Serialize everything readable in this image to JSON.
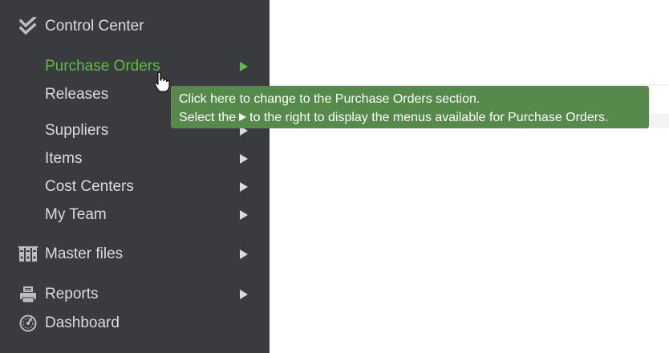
{
  "sidebar": {
    "items": [
      {
        "key": "control_center",
        "label": "Control Center",
        "icon": "double-check-icon",
        "has_arrow": false,
        "active": false
      },
      {
        "key": "purchase_orders",
        "label": "Purchase Orders",
        "icon": "",
        "has_arrow": true,
        "active": true
      },
      {
        "key": "releases",
        "label": "Releases",
        "icon": "",
        "has_arrow": false,
        "active": false
      },
      {
        "key": "suppliers",
        "label": "Suppliers",
        "icon": "",
        "has_arrow": true,
        "active": false
      },
      {
        "key": "items",
        "label": "Items",
        "icon": "",
        "has_arrow": true,
        "active": false
      },
      {
        "key": "cost_centers",
        "label": "Cost Centers",
        "icon": "",
        "has_arrow": true,
        "active": false
      },
      {
        "key": "my_team",
        "label": "My Team",
        "icon": "",
        "has_arrow": true,
        "active": false
      },
      {
        "key": "master_files",
        "label": "Master files",
        "icon": "binders-icon",
        "has_arrow": true,
        "active": false
      },
      {
        "key": "reports",
        "label": "Reports",
        "icon": "printer-icon",
        "has_arrow": true,
        "active": false
      },
      {
        "key": "dashboard",
        "label": "Dashboard",
        "icon": "gauge-icon",
        "has_arrow": false,
        "active": false
      }
    ]
  },
  "tooltip": {
    "line1": "Click here to change to the Purchase Orders section.",
    "line2_before": "Select the",
    "line2_after": "to the right to display the menus available for Purchase Orders."
  },
  "colors": {
    "sidebar_bg": "#3a3b3e",
    "menu_text": "#dcdcdc",
    "active_text": "#5cbf3f",
    "tooltip_bg": "#568a4a"
  }
}
